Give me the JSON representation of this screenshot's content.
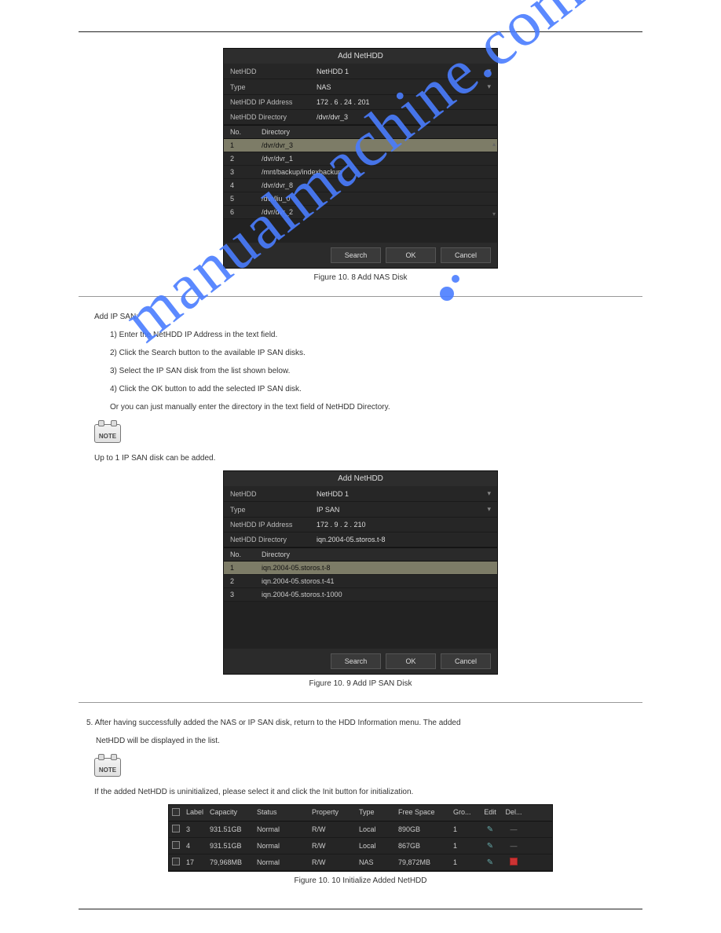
{
  "watermark": "manualmachine.com",
  "section": {
    "caption1": "Figure 10. 8 Add NAS Disk",
    "ipsan_intro": "Add IP SAN:",
    "step1": "1)  Enter the NetHDD IP Address in the text field.",
    "step2": "2)  Click the Search button to the available IP SAN disks.",
    "step3": "3)  Select the IP SAN disk from the list shown below.",
    "step4": "4)  Click the OK button to add the selected IP SAN disk.",
    "or": "Or you can just manually enter the directory in the text field of NetHDD Directory.",
    "note1": "Up to 1 IP SAN disk can be added.",
    "caption2": "Figure 10. 9 Add IP SAN Disk",
    "step5_p1": "5. After having successfully added the NAS or IP SAN disk, return to the HDD Information menu. The added",
    "step5_p2": "NetHDD will be displayed in the list.",
    "note2": "If the added NetHDD is uninitialized, please select it and click the Init button for initialization.",
    "caption3": "Figure 10. 10 Initialize Added NetHDD"
  },
  "dialog1": {
    "title": "Add NetHDD",
    "fields": {
      "nethdd_label": "NetHDD",
      "nethdd_value": "NetHDD 1",
      "type_label": "Type",
      "type_value": "NAS",
      "ip_label": "NetHDD IP Address",
      "ip_value": "172 . 6   . 24  . 201",
      "dir_label": "NetHDD Directory",
      "dir_value": "/dvr/dvr_3"
    },
    "columns": {
      "no": "No.",
      "dir": "Directory"
    },
    "rows": [
      {
        "no": "1",
        "dir": "/dvr/dvr_3",
        "sel": true
      },
      {
        "no": "2",
        "dir": "/dvr/dvr_1"
      },
      {
        "no": "3",
        "dir": "/mnt/backup/indexbackup"
      },
      {
        "no": "4",
        "dir": "/dvr/dvr_8"
      },
      {
        "no": "5",
        "dir": "/dvr/liu_0"
      },
      {
        "no": "6",
        "dir": "/dvr/dvr_2"
      }
    ],
    "buttons": {
      "search": "Search",
      "ok": "OK",
      "cancel": "Cancel"
    }
  },
  "dialog2": {
    "title": "Add NetHDD",
    "fields": {
      "nethdd_label": "NetHDD",
      "nethdd_value": "NetHDD 1",
      "type_label": "Type",
      "type_value": "IP SAN",
      "ip_label": "NetHDD IP Address",
      "ip_value": "172 . 9   . 2   . 210",
      "dir_label": "NetHDD Directory",
      "dir_value": "iqn.2004-05.storos.t-8"
    },
    "columns": {
      "no": "No.",
      "dir": "Directory"
    },
    "rows": [
      {
        "no": "1",
        "dir": "iqn.2004-05.storos.t-8",
        "sel": true
      },
      {
        "no": "2",
        "dir": "iqn.2004-05.storos.t-41"
      },
      {
        "no": "3",
        "dir": "iqn.2004-05.storos.t-1000"
      }
    ],
    "buttons": {
      "search": "Search",
      "ok": "OK",
      "cancel": "Cancel"
    }
  },
  "hdd": {
    "headers": {
      "label": "Label",
      "capacity": "Capacity",
      "status": "Status",
      "property": "Property",
      "type": "Type",
      "free": "Free Space",
      "gro": "Gro...",
      "edit": "Edit",
      "del": "Del..."
    },
    "rows": [
      {
        "label": "3",
        "capacity": "931.51GB",
        "status": "Normal",
        "property": "R/W",
        "type": "Local",
        "free": "890GB",
        "gro": "1",
        "del": "dash"
      },
      {
        "label": "4",
        "capacity": "931.51GB",
        "status": "Normal",
        "property": "R/W",
        "type": "Local",
        "free": "867GB",
        "gro": "1",
        "del": "dash"
      },
      {
        "label": "17",
        "capacity": "79,968MB",
        "status": "Normal",
        "property": "R/W",
        "type": "NAS",
        "free": "79,872MB",
        "gro": "1",
        "del": "trash"
      }
    ]
  },
  "note_label": "NOTE"
}
